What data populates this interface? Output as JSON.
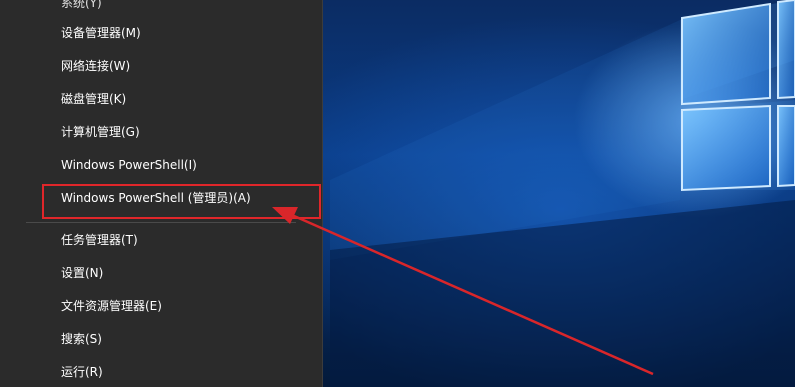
{
  "menu": {
    "items": [
      {
        "label": "系统(Y)"
      },
      {
        "label": "设备管理器(M)"
      },
      {
        "label": "网络连接(W)"
      },
      {
        "label": "磁盘管理(K)"
      },
      {
        "label": "计算机管理(G)"
      },
      {
        "label": "Windows PowerShell(I)"
      },
      {
        "label": "Windows PowerShell (管理员)(A)"
      },
      {
        "label": "任务管理器(T)"
      },
      {
        "label": "设置(N)"
      },
      {
        "label": "文件资源管理器(E)"
      },
      {
        "label": "搜索(S)"
      },
      {
        "label": "运行(R)"
      }
    ]
  },
  "annotation": {
    "highlight_color": "#e0262a",
    "highlighted_item": "Windows PowerShell (管理员)(A)"
  },
  "colors": {
    "menu_background": "#2b2b2b",
    "menu_text": "#ffffff",
    "desktop_blue": "#0a3c86"
  }
}
